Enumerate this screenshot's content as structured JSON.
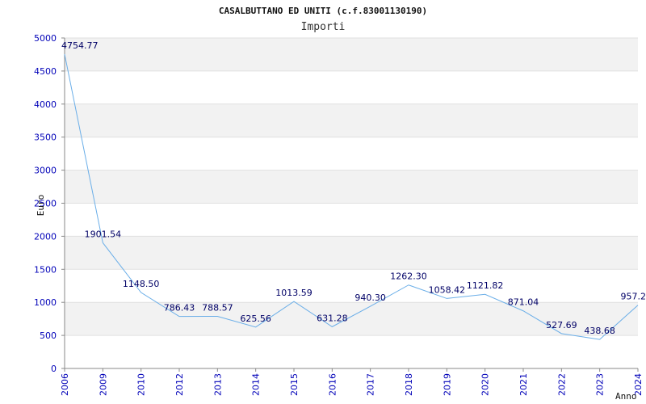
{
  "chart_data": {
    "type": "line",
    "title": "CASALBUTTANO ED UNITI (c.f.83001130190)",
    "subtitle": "Importi",
    "xlabel": "Anno",
    "ylabel": "Euro",
    "categories": [
      "2006",
      "2009",
      "2010",
      "2012",
      "2013",
      "2014",
      "2015",
      "2016",
      "2017",
      "2018",
      "2019",
      "2020",
      "2021",
      "2022",
      "2023",
      "2024"
    ],
    "values": [
      4754.77,
      1901.54,
      1148.5,
      786.43,
      788.57,
      625.56,
      1013.59,
      631.28,
      940.3,
      1262.3,
      1058.42,
      1121.82,
      871.04,
      527.69,
      438.68,
      957.2
    ],
    "value_labels": [
      "4754.77",
      "1901.54",
      "1148.50",
      "786.43",
      "788.57",
      "625.56",
      "1013.59",
      "631.28",
      "940.30",
      "1262.30",
      "1058.42",
      "1121.82",
      "871.04",
      "527.69",
      "438.68",
      "957.2"
    ],
    "ylim": [
      0,
      5000
    ],
    "yticks": [
      "0",
      "500",
      "1000",
      "1500",
      "2000",
      "2500",
      "3000",
      "3500",
      "4000",
      "4500",
      "5000"
    ],
    "grid": "horizontal bands",
    "colors": {
      "line": "#6aaee8",
      "band": "#f2f2f2",
      "tick_text": "#0000b8",
      "label_text": "#000066",
      "axis": "#888888"
    }
  }
}
